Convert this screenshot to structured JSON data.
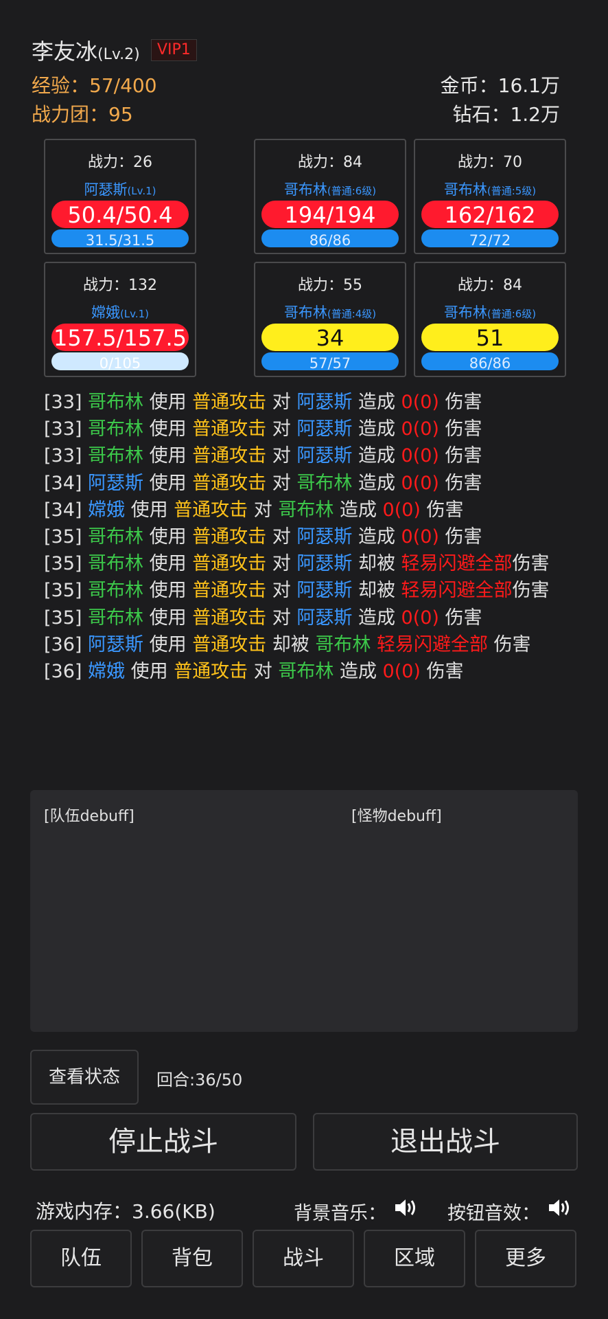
{
  "header": {
    "player_name": "李友冰",
    "player_level": "(Lv.2)",
    "vip": "VIP1",
    "exp": "经验：57/400",
    "power_team": "战力团：95",
    "gold": "金币：16.1万",
    "diamond": "钻石：1.2万"
  },
  "units": [
    {
      "power": "战力：26",
      "name": "阿瑟斯",
      "sub": "(Lv.1)",
      "hp": "50.4/50.4",
      "mp": "31.5/31.5"
    },
    {
      "power": "战力：84",
      "name": "哥布林",
      "sub": "(普通:6级)",
      "hp": "194/194",
      "mp": "86/86"
    },
    {
      "power": "战力：70",
      "name": "哥布林",
      "sub": "(普通:5级)",
      "hp": "162/162",
      "mp": "72/72"
    },
    {
      "power": "战力：132",
      "name": "嫦娥",
      "sub": "(Lv.1)",
      "hp": "157.5/157.5",
      "mp": "0/105"
    },
    {
      "power": "战力：55",
      "name": "哥布林",
      "sub": "(普通:4级)",
      "hp": "34",
      "mp": "57/57"
    },
    {
      "power": "战力：84",
      "name": "哥布林",
      "sub": "(普通:6级)",
      "hp": "51",
      "mp": "86/86"
    }
  ],
  "log_lines": [
    [
      [
        "w",
        "[33] "
      ],
      [
        "g",
        "哥布林"
      ],
      [
        "w",
        " 使用 "
      ],
      [
        "y",
        "普通攻击"
      ],
      [
        "w",
        " 对 "
      ],
      [
        "b",
        "阿瑟斯"
      ],
      [
        "w",
        " 造成 "
      ],
      [
        "r",
        "0(0)"
      ],
      [
        "w",
        " 伤害"
      ]
    ],
    [
      [
        "w",
        "[33] "
      ],
      [
        "g",
        "哥布林"
      ],
      [
        "w",
        " 使用 "
      ],
      [
        "y",
        "普通攻击"
      ],
      [
        "w",
        " 对 "
      ],
      [
        "b",
        "阿瑟斯"
      ],
      [
        "w",
        " 造成 "
      ],
      [
        "r",
        "0(0)"
      ],
      [
        "w",
        " 伤害"
      ]
    ],
    [
      [
        "w",
        "[33] "
      ],
      [
        "g",
        "哥布林"
      ],
      [
        "w",
        " 使用 "
      ],
      [
        "y",
        "普通攻击"
      ],
      [
        "w",
        " 对 "
      ],
      [
        "b",
        "阿瑟斯"
      ],
      [
        "w",
        " 造成 "
      ],
      [
        "r",
        "0(0)"
      ],
      [
        "w",
        " 伤害"
      ]
    ],
    [
      [
        "w",
        "[34] "
      ],
      [
        "b",
        "阿瑟斯"
      ],
      [
        "w",
        " 使用 "
      ],
      [
        "y",
        "普通攻击"
      ],
      [
        "w",
        " 对 "
      ],
      [
        "g",
        "哥布林"
      ],
      [
        "w",
        " 造成 "
      ],
      [
        "r",
        "0(0)"
      ],
      [
        "w",
        " 伤害"
      ]
    ],
    [
      [
        "w",
        "[34] "
      ],
      [
        "b",
        "嫦娥"
      ],
      [
        "w",
        " 使用 "
      ],
      [
        "y",
        "普通攻击"
      ],
      [
        "w",
        " 对 "
      ],
      [
        "g",
        "哥布林"
      ],
      [
        "w",
        " 造成 "
      ],
      [
        "r",
        "0(0)"
      ],
      [
        "w",
        " 伤害"
      ]
    ],
    [
      [
        "w",
        "[35] "
      ],
      [
        "g",
        "哥布林"
      ],
      [
        "w",
        " 使用 "
      ],
      [
        "y",
        "普通攻击"
      ],
      [
        "w",
        " 对 "
      ],
      [
        "b",
        "阿瑟斯"
      ],
      [
        "w",
        " 造成 "
      ],
      [
        "r",
        "0(0)"
      ],
      [
        "w",
        " 伤害"
      ]
    ],
    [
      [
        "w",
        "[35] "
      ],
      [
        "g",
        "哥布林"
      ],
      [
        "w",
        " 使用 "
      ],
      [
        "y",
        "普通攻击"
      ],
      [
        "w",
        " 对 "
      ],
      [
        "b",
        "阿瑟斯"
      ],
      [
        "w",
        " 却被 "
      ],
      [
        "r",
        "轻易闪避全部"
      ],
      [
        "w",
        "伤害"
      ]
    ],
    [
      [
        "w",
        "[35] "
      ],
      [
        "g",
        "哥布林"
      ],
      [
        "w",
        " 使用 "
      ],
      [
        "y",
        "普通攻击"
      ],
      [
        "w",
        " 对 "
      ],
      [
        "b",
        "阿瑟斯"
      ],
      [
        "w",
        " 却被 "
      ],
      [
        "r",
        "轻易闪避全部"
      ],
      [
        "w",
        "伤害"
      ]
    ],
    [
      [
        "w",
        "[35] "
      ],
      [
        "g",
        "哥布林"
      ],
      [
        "w",
        " 使用 "
      ],
      [
        "y",
        "普通攻击"
      ],
      [
        "w",
        " 对 "
      ],
      [
        "b",
        "阿瑟斯"
      ],
      [
        "w",
        " 造成 "
      ],
      [
        "r",
        "0(0)"
      ],
      [
        "w",
        " 伤害"
      ]
    ],
    [
      [
        "w",
        "[36] "
      ],
      [
        "b",
        "阿瑟斯"
      ],
      [
        "w",
        " 使用 "
      ],
      [
        "y",
        "普通攻击"
      ],
      [
        "w",
        " 却被 "
      ],
      [
        "g",
        "哥布林"
      ],
      [
        "w",
        " "
      ],
      [
        "r",
        "轻易闪避全部"
      ],
      [
        "w",
        " 伤害"
      ]
    ],
    [
      [
        "w",
        "[36] "
      ],
      [
        "b",
        "嫦娥"
      ],
      [
        "w",
        " 使用 "
      ],
      [
        "y",
        "普通攻击"
      ],
      [
        "w",
        " 对 "
      ],
      [
        "g",
        "哥布林"
      ],
      [
        "w",
        " 造成 "
      ],
      [
        "r",
        "0(0)"
      ],
      [
        "w",
        " 伤害"
      ]
    ]
  ],
  "debuff": {
    "team_label": "[队伍debuff]",
    "monster_label": "[怪物debuff]"
  },
  "controls": {
    "status_label": "查看状态",
    "round": "回合:36/50",
    "stop_label": "停止战斗",
    "exit_label": "退出战斗",
    "memory": "游戏内存：3.66(KB)",
    "bgm_label": "背景音乐：",
    "sfx_label": "按钮音效："
  },
  "icons": {
    "bgm": "speaker-icon",
    "sfx": "speaker-icon"
  },
  "nav": [
    {
      "label": "队伍"
    },
    {
      "label": "背包"
    },
    {
      "label": "战斗"
    },
    {
      "label": "区域"
    },
    {
      "label": "更多"
    }
  ]
}
